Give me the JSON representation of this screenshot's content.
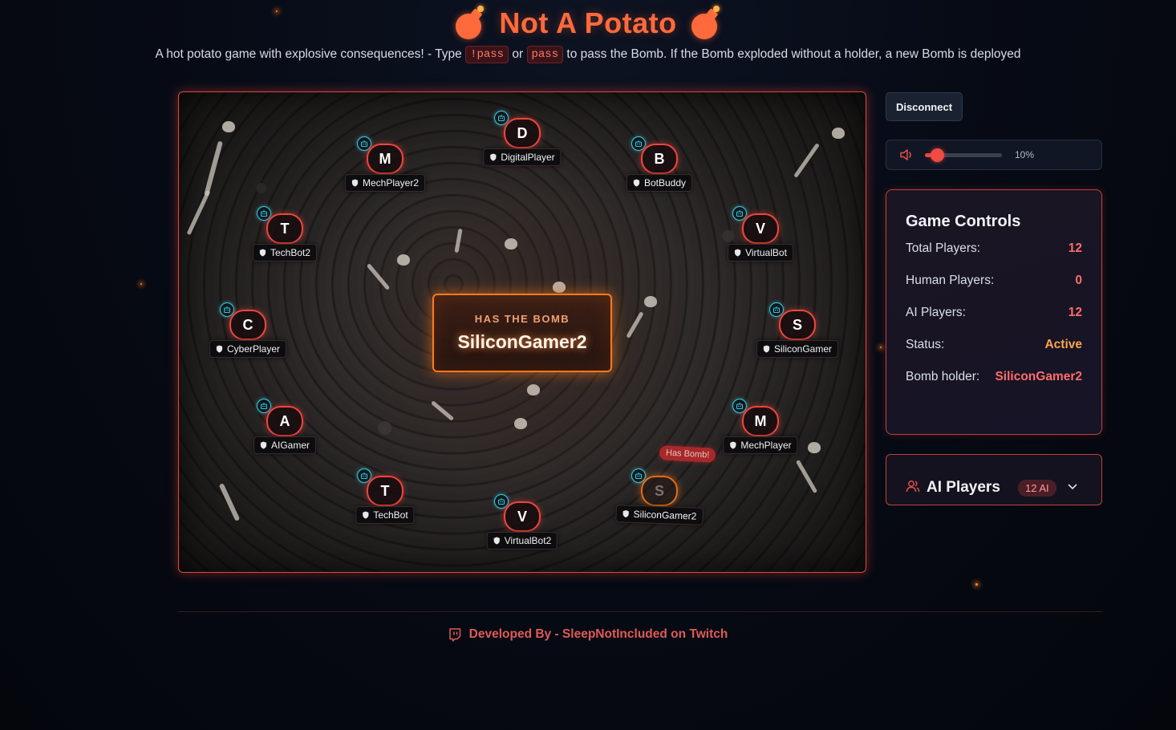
{
  "header": {
    "title": "Not A Potato",
    "subtitle_prefix": "A hot potato game with explosive consequences! - Type",
    "cmd_pass_bang": "!pass",
    "subtitle_or": "or",
    "cmd_pass": "pass",
    "subtitle_suffix": "to pass the Bomb. If the Bomb exploded without a holder, a new Bomb is deployed"
  },
  "arena": {
    "bomb_box_label": "HAS THE BOMB",
    "bomb_holder": "SiliconGamer2",
    "has_bomb_tag": "Has Bomb!",
    "players": [
      {
        "initial": "D",
        "name": "DigitalPlayer"
      },
      {
        "initial": "M",
        "name": "MechPlayer2"
      },
      {
        "initial": "B",
        "name": "BotBuddy"
      },
      {
        "initial": "T",
        "name": "TechBot2"
      },
      {
        "initial": "V",
        "name": "VirtualBot"
      },
      {
        "initial": "C",
        "name": "CyberPlayer"
      },
      {
        "initial": "S",
        "name": "SiliconGamer"
      },
      {
        "initial": "A",
        "name": "AIGamer"
      },
      {
        "initial": "M",
        "name": "MechPlayer"
      },
      {
        "initial": "T",
        "name": "TechBot"
      },
      {
        "initial": "V",
        "name": "VirtualBot2"
      },
      {
        "initial": "S",
        "name": "SiliconGamer2"
      }
    ]
  },
  "toolbar": {
    "disconnect_label": "Disconnect",
    "volume_percent": 10,
    "volume_label": "10%"
  },
  "game_controls": {
    "title": "Game Controls",
    "rows": [
      {
        "label": "Total Players:",
        "value": "12"
      },
      {
        "label": "Human Players:",
        "value": "0"
      },
      {
        "label": "AI Players:",
        "value": "12"
      },
      {
        "label": "Status:",
        "value": "Active"
      },
      {
        "label": "Bomb holder:",
        "value": "SiliconGamer2"
      }
    ]
  },
  "ai_players_panel": {
    "title": "AI Players",
    "count_badge": "12 AI"
  },
  "footer": {
    "text": "Developed By - SleepNotIncluded on Twitch"
  },
  "colors": {
    "accent": "#ff6a3d",
    "border_red": "#e0463c",
    "bomb_orange": "#ff7a1a",
    "bot_badge": "#3fc8d8"
  },
  "icons": [
    "bomb-icon",
    "robot-icon",
    "shield-icon",
    "speaker-icon",
    "users-icon",
    "chevron-down-icon",
    "twitch-icon"
  ]
}
